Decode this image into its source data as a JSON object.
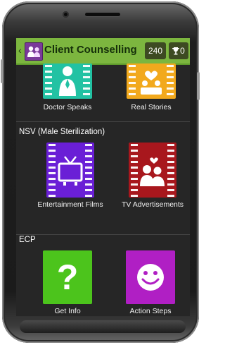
{
  "app": {
    "title": "Client Counselling",
    "score": "240",
    "trophies": "0"
  },
  "sections": [
    {
      "title": ""
    },
    {
      "title": "NSV (Male Sterilization)"
    },
    {
      "title": "ECP"
    }
  ],
  "tiles": {
    "doctor_speaks": "Doctor Speaks",
    "real_stories": "Real Stories",
    "entertainment_films": "Entertainment Films",
    "tv_advertisements": "TV Advertisements",
    "get_info": "Get Info",
    "action_steps": "Action Steps"
  },
  "glyphs": {
    "question": "?"
  },
  "colors": {
    "appbar": "#7cb63f",
    "doctor": "#22c2a3",
    "real": "#f2a91d",
    "entertainment": "#6a1fd6",
    "tv": "#a8171d",
    "get_info": "#4cc41c",
    "action_steps": "#b01fc4"
  }
}
